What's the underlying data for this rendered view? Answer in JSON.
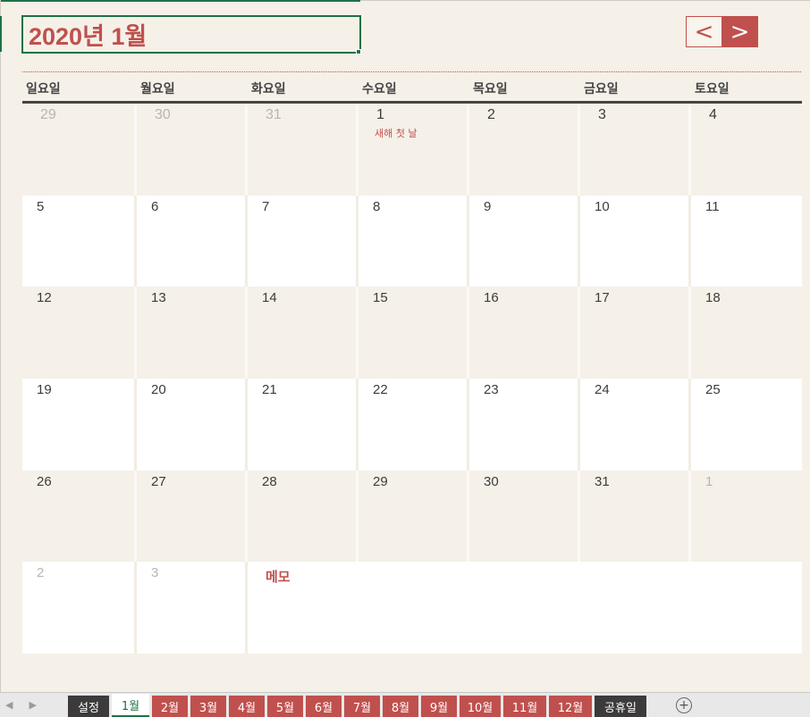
{
  "title": "2020년 1월",
  "nav": {
    "prev": "<",
    "next": ">"
  },
  "weekdays": [
    "일요일",
    "월요일",
    "화요일",
    "수요일",
    "목요일",
    "금요일",
    "토요일"
  ],
  "weeks": [
    [
      {
        "d": "29",
        "o": true
      },
      {
        "d": "30",
        "o": true
      },
      {
        "d": "31",
        "o": true
      },
      {
        "d": "1",
        "o": false,
        "note": "새해 첫 날"
      },
      {
        "d": "2",
        "o": false
      },
      {
        "d": "3",
        "o": false
      },
      {
        "d": "4",
        "o": false
      }
    ],
    [
      {
        "d": "5"
      },
      {
        "d": "6"
      },
      {
        "d": "7"
      },
      {
        "d": "8"
      },
      {
        "d": "9"
      },
      {
        "d": "10"
      },
      {
        "d": "11"
      }
    ],
    [
      {
        "d": "12"
      },
      {
        "d": "13"
      },
      {
        "d": "14"
      },
      {
        "d": "15"
      },
      {
        "d": "16"
      },
      {
        "d": "17"
      },
      {
        "d": "18"
      }
    ],
    [
      {
        "d": "19"
      },
      {
        "d": "20"
      },
      {
        "d": "21"
      },
      {
        "d": "22"
      },
      {
        "d": "23"
      },
      {
        "d": "24"
      },
      {
        "d": "25"
      }
    ],
    [
      {
        "d": "26"
      },
      {
        "d": "27"
      },
      {
        "d": "28"
      },
      {
        "d": "29"
      },
      {
        "d": "30"
      },
      {
        "d": "31"
      },
      {
        "d": "1",
        "o": true
      }
    ],
    [
      {
        "d": "2",
        "o": true
      },
      {
        "d": "3",
        "o": true
      }
    ]
  ],
  "memo_label": "메모",
  "sheet_tabs": [
    {
      "label": "설정",
      "style": "dark",
      "width": 46
    },
    {
      "label": "1월",
      "style": "active",
      "width": 42
    },
    {
      "label": "2월",
      "style": "red",
      "width": 40
    },
    {
      "label": "3월",
      "style": "red",
      "width": 40
    },
    {
      "label": "4월",
      "style": "red",
      "width": 40
    },
    {
      "label": "5월",
      "style": "red",
      "width": 40
    },
    {
      "label": "6월",
      "style": "red",
      "width": 40
    },
    {
      "label": "7월",
      "style": "red",
      "width": 40
    },
    {
      "label": "8월",
      "style": "red",
      "width": 40
    },
    {
      "label": "9월",
      "style": "red",
      "width": 40
    },
    {
      "label": "10월",
      "style": "red",
      "width": 46
    },
    {
      "label": "11월",
      "style": "red",
      "width": 48
    },
    {
      "label": "12월",
      "style": "red",
      "width": 48
    },
    {
      "label": "공휴일",
      "style": "dark",
      "width": 58
    }
  ],
  "colors": {
    "accent": "#c0504d",
    "selection": "#1e7145",
    "dark": "#3c3a3a",
    "background": "#f5f0e8"
  }
}
